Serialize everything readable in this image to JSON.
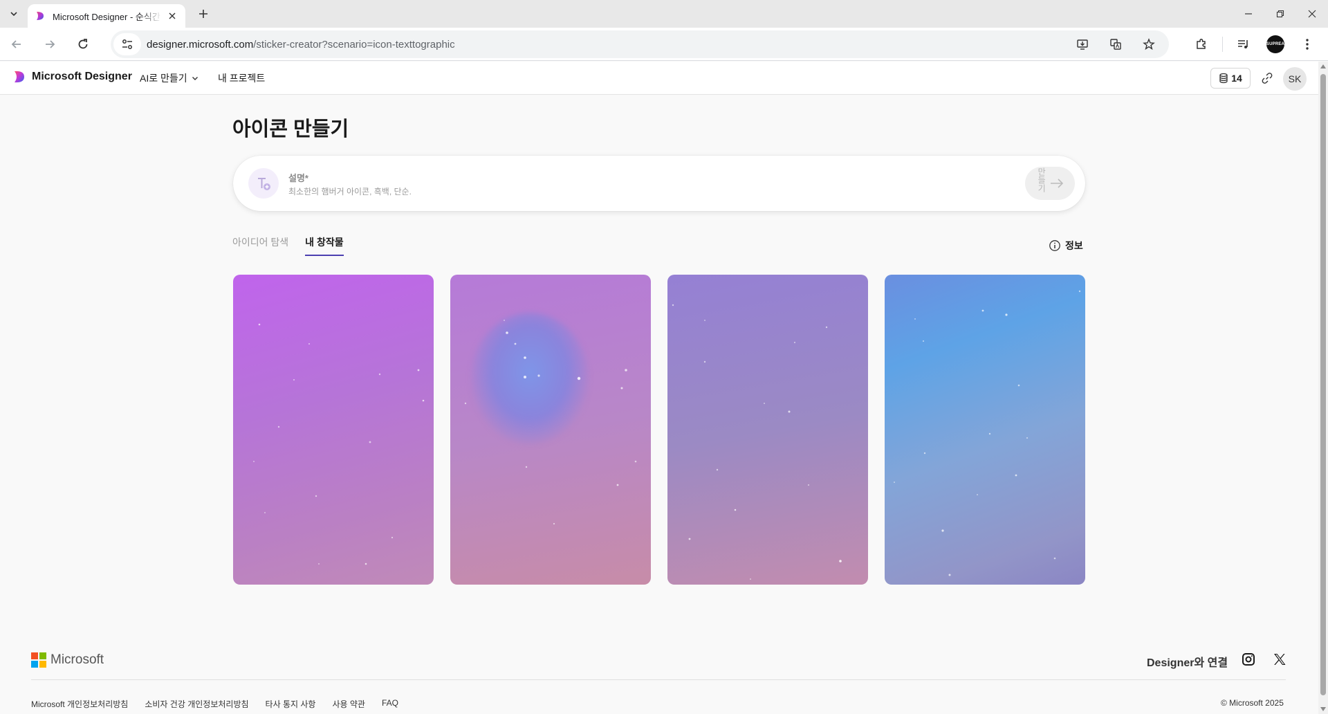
{
  "browser": {
    "tab_title": "Microsoft Designer - 순식간",
    "url_host": "designer.microsoft.com",
    "url_path": "/sticker-creator?scenario=icon-texttographic",
    "profile_label": "SUPREA"
  },
  "header": {
    "brand": "Microsoft Designer",
    "nav_ai": "AI로 만들기",
    "nav_projects": "내 프로젝트",
    "credits": "14",
    "avatar_initials": "SK"
  },
  "main": {
    "title": "아이콘 만들기",
    "prompt": {
      "label": "설명*",
      "placeholder": "최소한의 햄버거 아이콘, 흑백, 단순.",
      "submit_label": "만들기"
    },
    "tabs": [
      {
        "label": "아이디어 탐색",
        "active": false
      },
      {
        "label": "내 창작물",
        "active": true
      }
    ],
    "info_label": "정보"
  },
  "footer": {
    "brand": "Microsoft",
    "connect": "Designer와 연결",
    "links": [
      "Microsoft 개인정보처리방침",
      "소비자 건강 개인정보처리방침",
      "타사 통지 사항",
      "사용 약관",
      "FAQ"
    ],
    "copyright": "© Microsoft 2025"
  },
  "colors": {
    "accent": "#4b3fb0",
    "ms_red": "#f25022",
    "ms_green": "#7fba00",
    "ms_blue": "#00a4ef",
    "ms_yellow": "#ffb900"
  }
}
